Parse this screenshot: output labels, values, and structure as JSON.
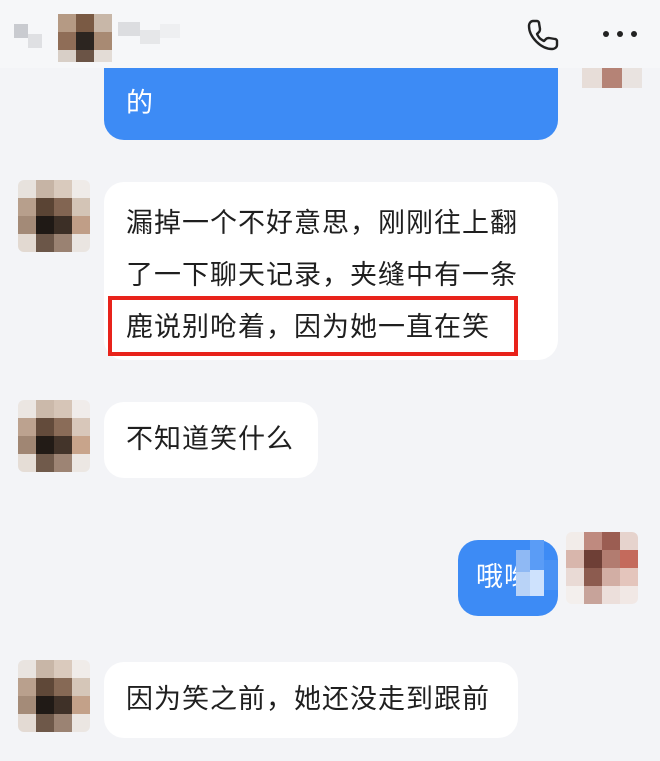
{
  "header": {
    "call_icon": "phone-icon",
    "more_icon": "more-horizontal-icon"
  },
  "messages": [
    {
      "direction": "outgoing",
      "lines": [
        "的"
      ]
    },
    {
      "direction": "incoming",
      "lines": [
        "漏掉一个不好意思，刚刚往上翻",
        "了一下聊天记录，夹缝中有一条",
        "鹿说别呛着，因为她一直在笑"
      ],
      "highlighted_line": 2
    },
    {
      "direction": "incoming",
      "lines": [
        "不知道笑什么"
      ]
    },
    {
      "direction": "outgoing",
      "lines": [
        "哦哟"
      ]
    },
    {
      "direction": "incoming",
      "lines": [
        "因为笑之前，她还没走到跟前"
      ]
    }
  ],
  "colors": {
    "background": "#f3f4f7",
    "incoming_bubble": "#ffffff",
    "outgoing_bubble": "#3d8bf5",
    "highlight": "#e8231b"
  }
}
